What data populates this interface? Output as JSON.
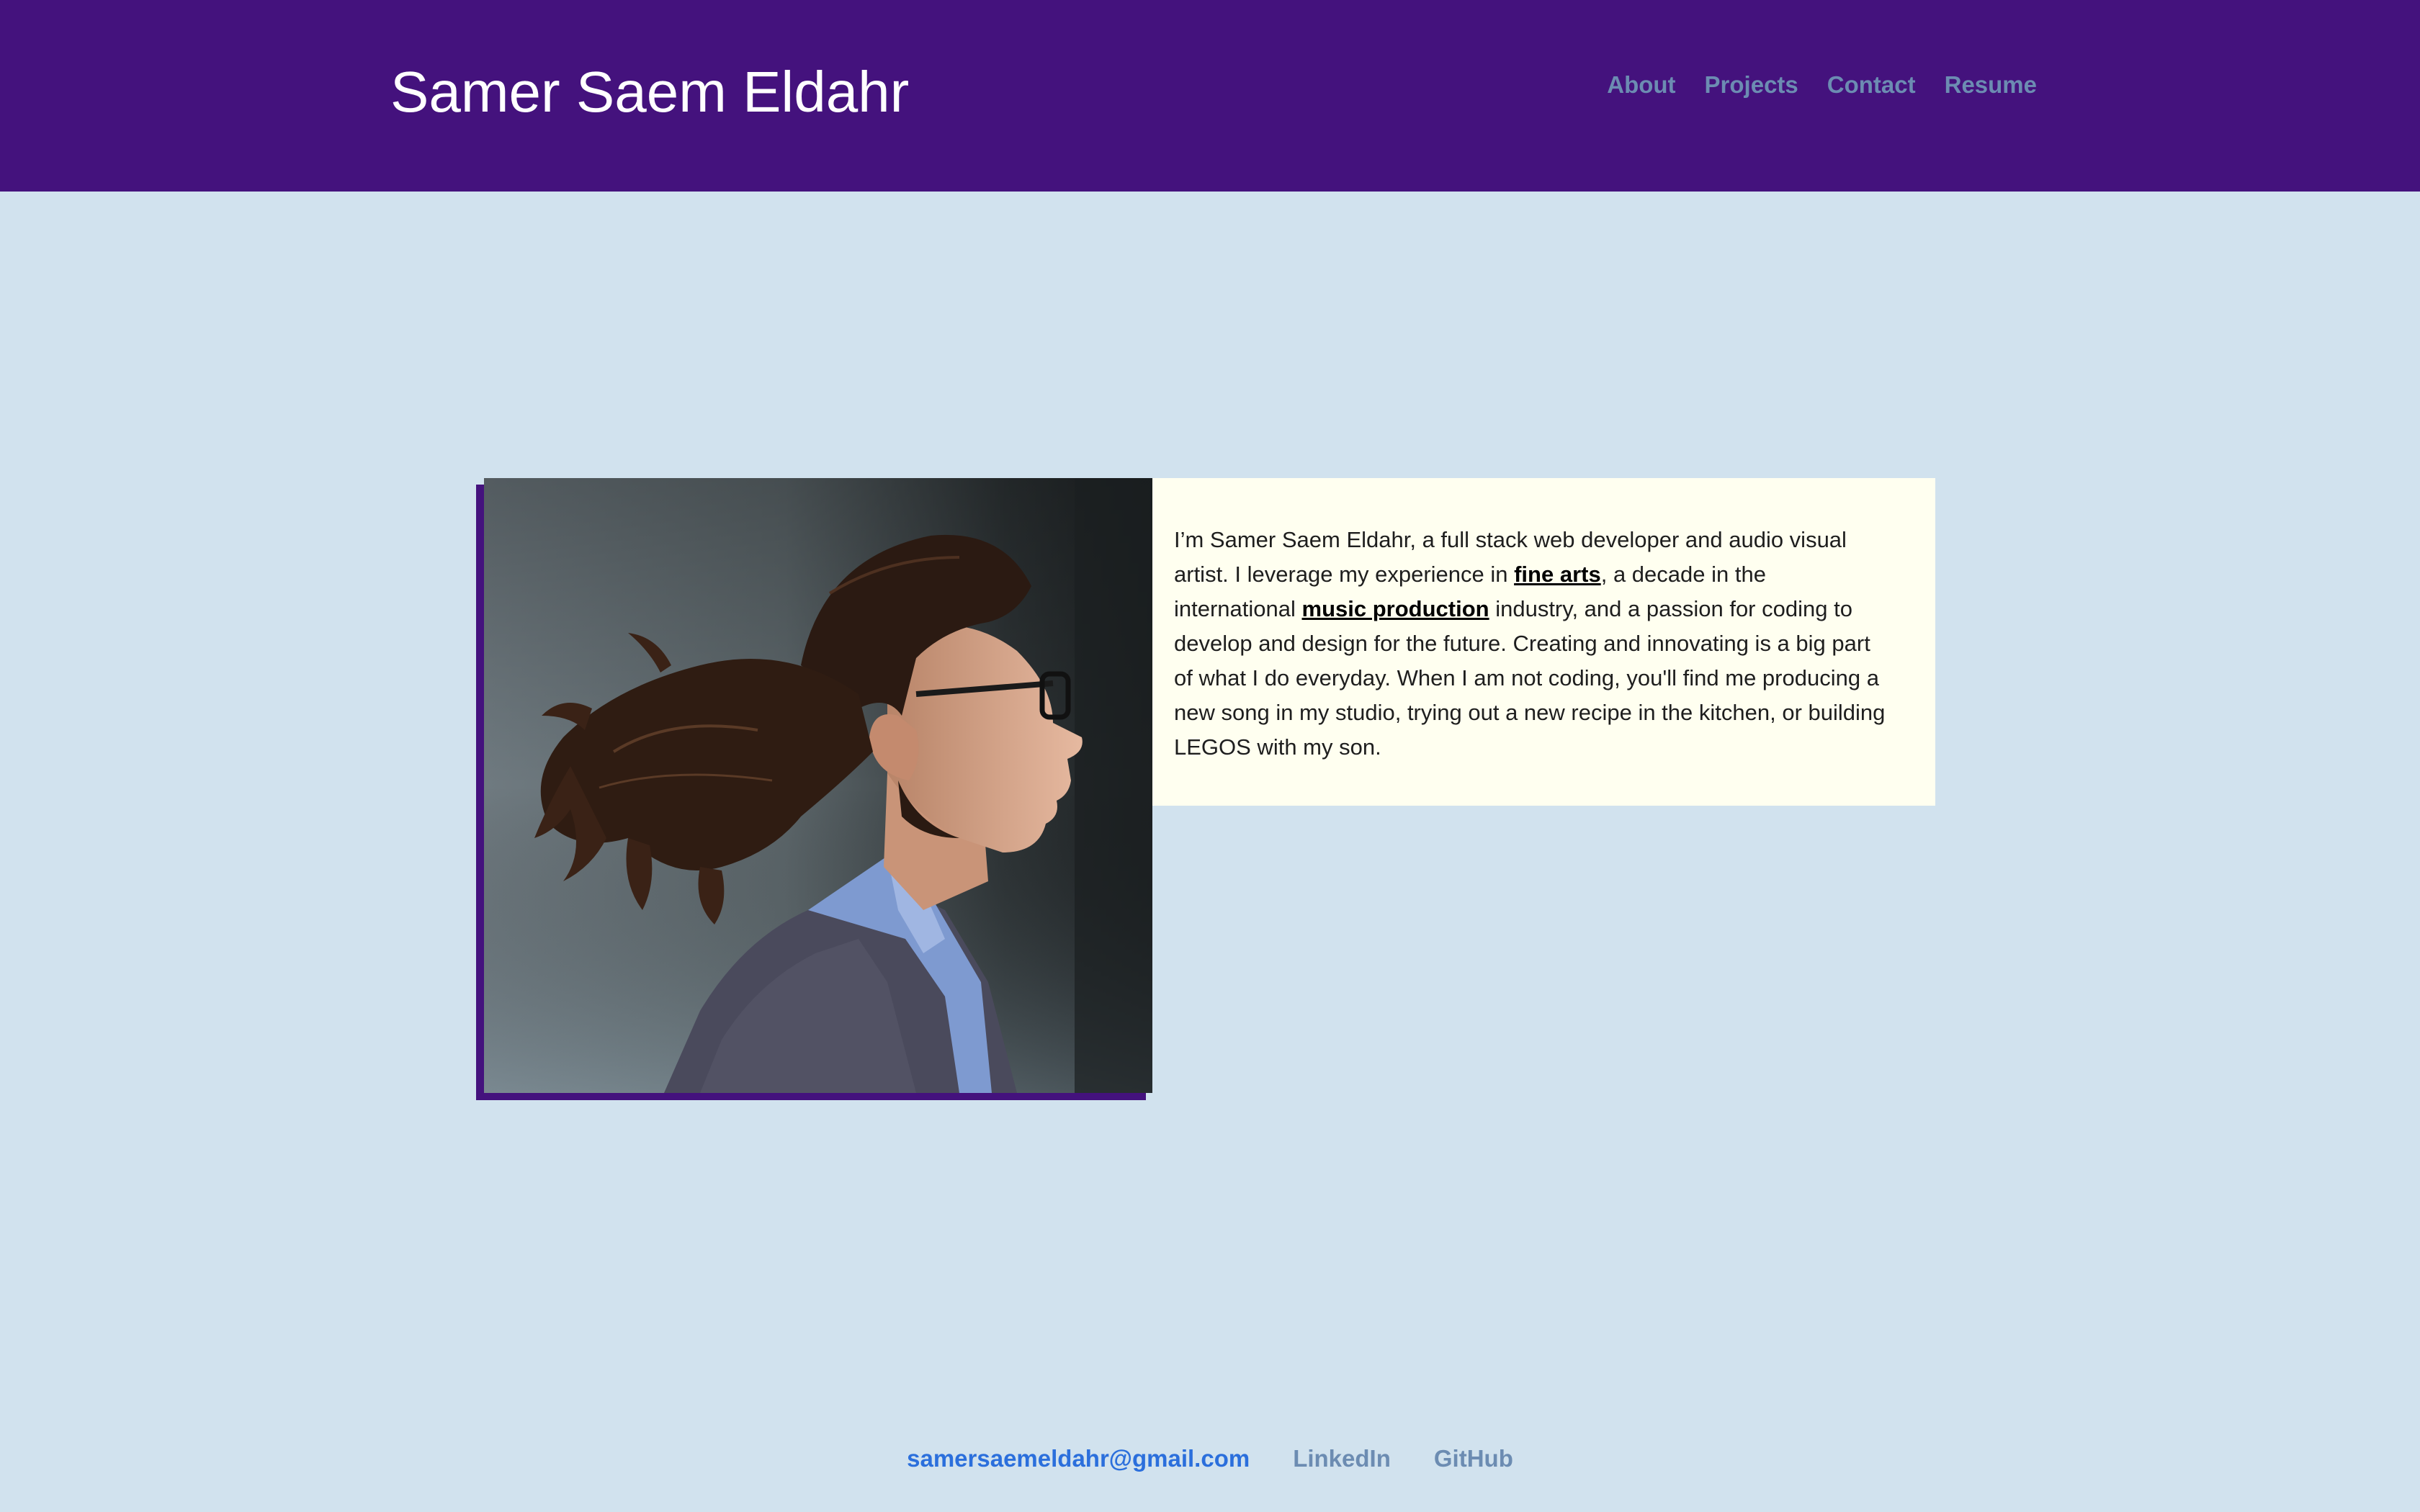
{
  "header": {
    "title": "Samer Saem Eldahr",
    "nav": [
      {
        "label": "About"
      },
      {
        "label": "Projects"
      },
      {
        "label": "Contact"
      },
      {
        "label": "Resume"
      }
    ]
  },
  "main": {
    "bio": {
      "intro": "I’m Samer Saem Eldahr, a full stack web developer and audio visual artist. I leverage my experience in ",
      "link1": "fine arts",
      "middle": ", a decade in the international ",
      "link2": "music production",
      "outro": " industry, and a passion for coding to develop and design for the future. Creating and innovating is a big part of what I do everyday. When I am not coding, you'll find me producing a new song in my studio, trying out a new recipe in the kitchen, or building LEGOS with my son."
    }
  },
  "footer": {
    "email": "samersaemeldahr@gmail.com",
    "linkedin": "LinkedIn",
    "github": "GitHub"
  },
  "colors": {
    "header_bg": "#44127d",
    "page_bg": "#d1e2ee",
    "bio_bg": "#fffff0",
    "nav_link": "#6c8cb2",
    "email_link": "#2b6fdc"
  }
}
